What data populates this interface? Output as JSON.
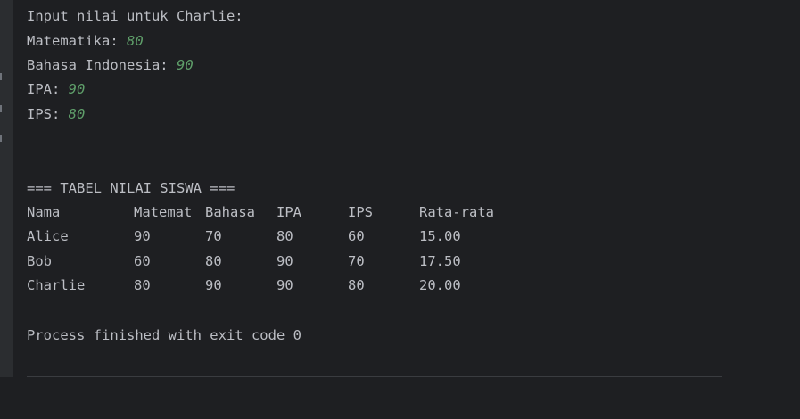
{
  "console": {
    "prompt": "Input nilai untuk Charlie:",
    "inputs": [
      {
        "label": "Matematika: ",
        "value": "80"
      },
      {
        "label": "Bahasa Indonesia: ",
        "value": "90"
      },
      {
        "label": "IPA: ",
        "value": "90"
      },
      {
        "label": "IPS: ",
        "value": "80"
      }
    ],
    "table_title": "=== TABEL NILAI SISWA ===",
    "headers": [
      "Nama",
      "Matemat",
      "Bahasa",
      "IPA",
      "IPS",
      "Rata-rata"
    ],
    "rows": [
      [
        "Alice",
        "90",
        "70",
        "80",
        "60",
        "15.00"
      ],
      [
        "Bob",
        "60",
        "80",
        "90",
        "70",
        "17.50"
      ],
      [
        "Charlie",
        "80",
        "90",
        "90",
        "80",
        "20.00"
      ]
    ],
    "exit_message": "Process finished with exit code 0"
  },
  "colors": {
    "background": "#1e1f22",
    "text": "#bcbec4",
    "input_value": "#5f9f6a",
    "gutter": "#2b2d30"
  }
}
